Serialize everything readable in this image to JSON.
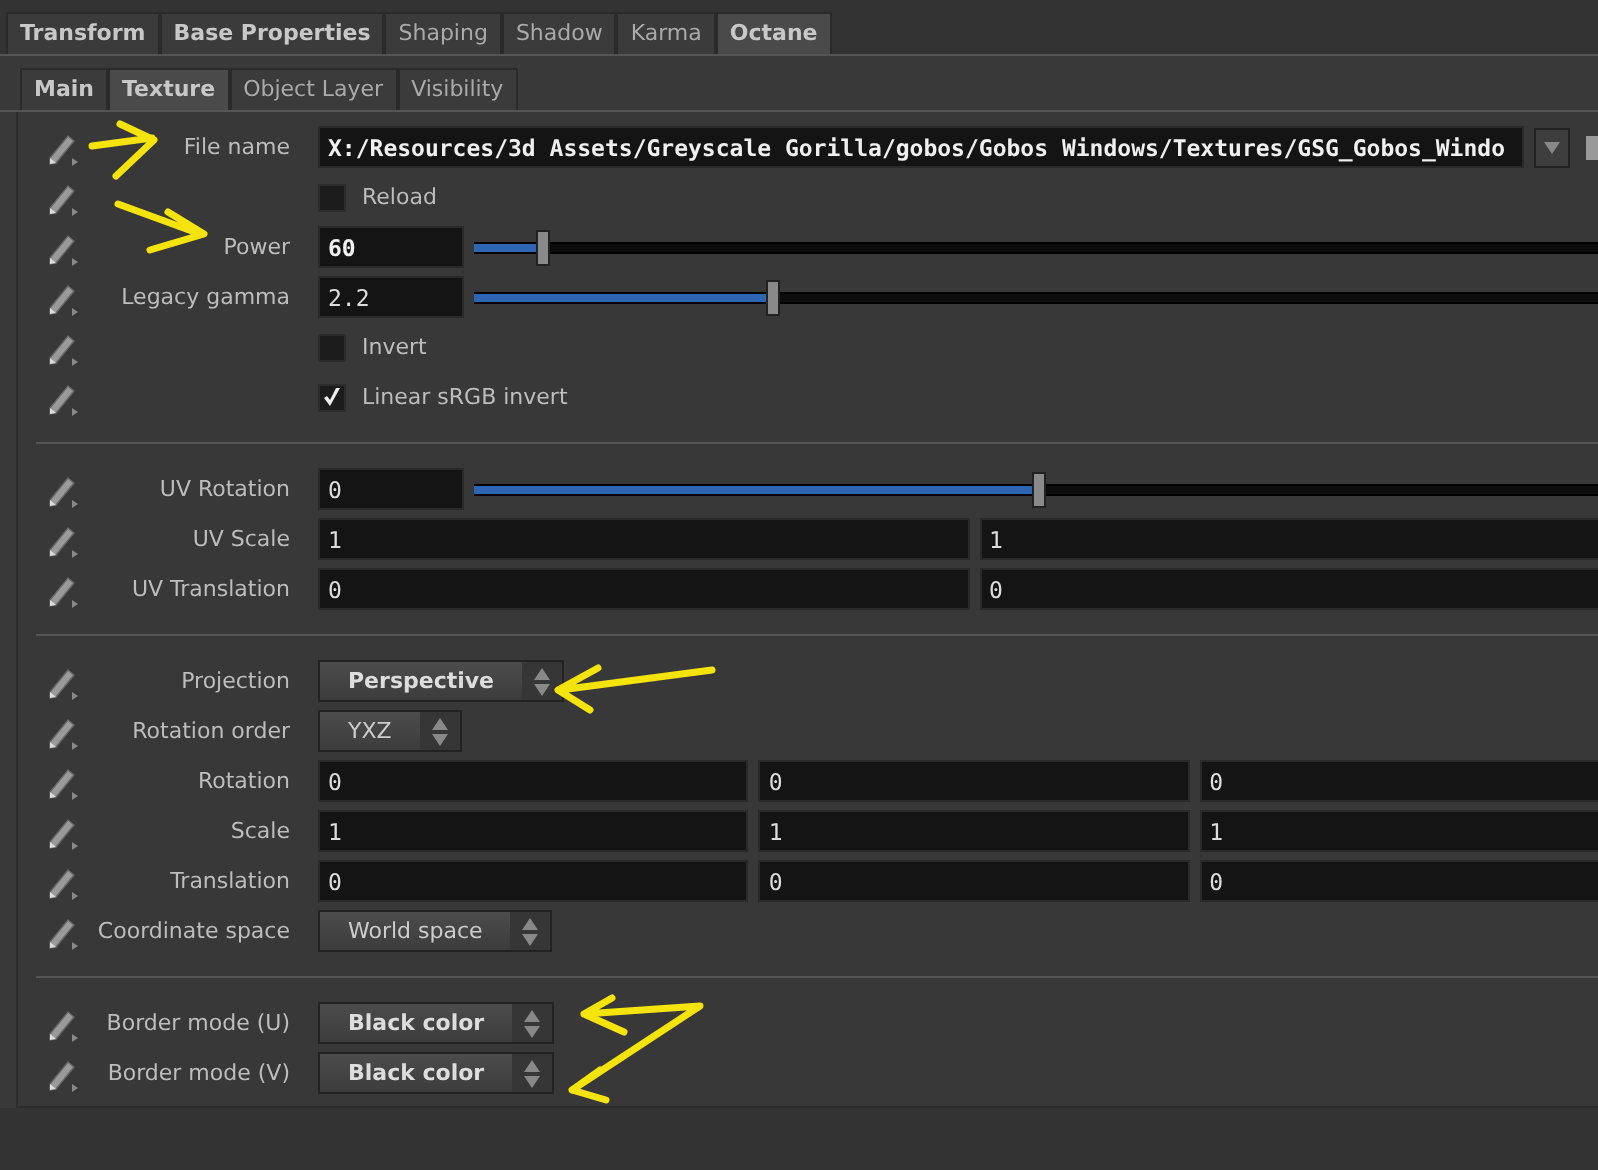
{
  "tabs": [
    {
      "label": "Transform",
      "bold": true,
      "selected": false
    },
    {
      "label": "Base Properties",
      "bold": true,
      "selected": false
    },
    {
      "label": "Shaping",
      "bold": false,
      "selected": false
    },
    {
      "label": "Shadow",
      "bold": false,
      "selected": false
    },
    {
      "label": "Karma",
      "bold": false,
      "selected": false
    },
    {
      "label": "Octane",
      "bold": true,
      "selected": true
    }
  ],
  "subtabs": [
    {
      "label": "Main",
      "bold": true,
      "selected": false
    },
    {
      "label": "Texture",
      "bold": true,
      "selected": true
    },
    {
      "label": "Object Layer",
      "bold": false,
      "selected": false
    },
    {
      "label": "Visibility",
      "bold": false,
      "selected": false
    }
  ],
  "sections": [
    {
      "rows": [
        {
          "kind": "file",
          "label": "File name",
          "value": "X:/Resources/3d Assets/Greyscale Gorilla/gobos/Gobos Windows/Textures/GSG_Gobos_Windo",
          "modified": true
        },
        {
          "kind": "checkbox",
          "label": "Reload",
          "checked": false
        },
        {
          "kind": "slider",
          "label": "Power",
          "value": "60",
          "modified": true,
          "level": 0.06
        },
        {
          "kind": "slider",
          "label": "Legacy gamma",
          "value": "2.2",
          "modified": false,
          "level": 0.26
        },
        {
          "kind": "checkbox",
          "label": "Invert",
          "checked": false
        },
        {
          "kind": "checkbox",
          "label": "Linear sRGB invert",
          "checked": true
        }
      ]
    },
    {
      "rows": [
        {
          "kind": "slider",
          "label": "UV Rotation",
          "value": "0",
          "modified": false,
          "level": 0.49
        },
        {
          "kind": "vector",
          "label": "UV Scale",
          "values": [
            "1",
            "1"
          ]
        },
        {
          "kind": "vector",
          "label": "UV Translation",
          "values": [
            "0",
            "0"
          ]
        }
      ]
    },
    {
      "rows": [
        {
          "kind": "menu",
          "label": "Projection",
          "value": "Perspective",
          "modified": true
        },
        {
          "kind": "menu",
          "label": "Rotation order",
          "value": "YXZ",
          "modified": false
        },
        {
          "kind": "vector",
          "label": "Rotation",
          "values": [
            "0",
            "0",
            "0"
          ]
        },
        {
          "kind": "vector",
          "label": "Scale",
          "values": [
            "1",
            "1",
            "1"
          ]
        },
        {
          "kind": "vector",
          "label": "Translation",
          "values": [
            "0",
            "0",
            "0"
          ]
        },
        {
          "kind": "menu",
          "label": "Coordinate space",
          "value": "World space",
          "modified": false
        }
      ]
    },
    {
      "rows": [
        {
          "kind": "menu",
          "label": "Border mode (U)",
          "value": "Black color",
          "modified": true
        },
        {
          "kind": "menu",
          "label": "Border mode (V)",
          "value": "Black color",
          "modified": true
        }
      ]
    }
  ]
}
